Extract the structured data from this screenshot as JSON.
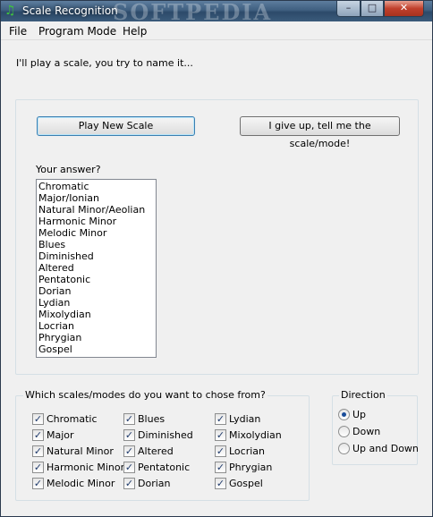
{
  "window": {
    "title": "Scale Recognition",
    "watermark": "SOFTPEDIA"
  },
  "titlebar_buttons": {
    "minimize": "–",
    "maximize": "□",
    "close": "✕"
  },
  "menu": [
    "File",
    "Program Mode",
    "Help"
  ],
  "prompt": "I'll play a scale, you try to name it...",
  "buttons": {
    "play": "Play New Scale",
    "giveup": "I give up, tell me the scale/mode!"
  },
  "answer_label": "Your answer?",
  "answers": [
    "Chromatic",
    "Major/Ionian",
    "Natural Minor/Aeolian",
    "Harmonic Minor",
    "Melodic Minor",
    "Blues",
    "Diminished",
    "Altered",
    "Pentatonic",
    "Dorian",
    "Lydian",
    "Mixolydian",
    "Locrian",
    "Phrygian",
    "Gospel"
  ],
  "scales_group": {
    "label": "Which scales/modes do you want to chose from?",
    "options": [
      {
        "label": "Chromatic",
        "checked": true
      },
      {
        "label": "Major",
        "checked": true
      },
      {
        "label": "Natural Minor",
        "checked": true
      },
      {
        "label": "Harmonic Minor",
        "checked": true
      },
      {
        "label": "Melodic Minor",
        "checked": true
      },
      {
        "label": "Blues",
        "checked": true
      },
      {
        "label": "Diminished",
        "checked": true
      },
      {
        "label": "Altered",
        "checked": true
      },
      {
        "label": "Pentatonic",
        "checked": true
      },
      {
        "label": "Dorian",
        "checked": true
      },
      {
        "label": "Lydian",
        "checked": true
      },
      {
        "label": "Mixolydian",
        "checked": true
      },
      {
        "label": "Locrian",
        "checked": true
      },
      {
        "label": "Phrygian",
        "checked": true
      },
      {
        "label": "Gospel",
        "checked": true
      }
    ]
  },
  "direction_group": {
    "label": "Direction",
    "options": [
      {
        "label": "Up",
        "selected": true
      },
      {
        "label": "Down",
        "selected": false
      },
      {
        "label": "Up and Down",
        "selected": false
      }
    ]
  },
  "check_mark": "✓",
  "icon_glyph": "♫"
}
